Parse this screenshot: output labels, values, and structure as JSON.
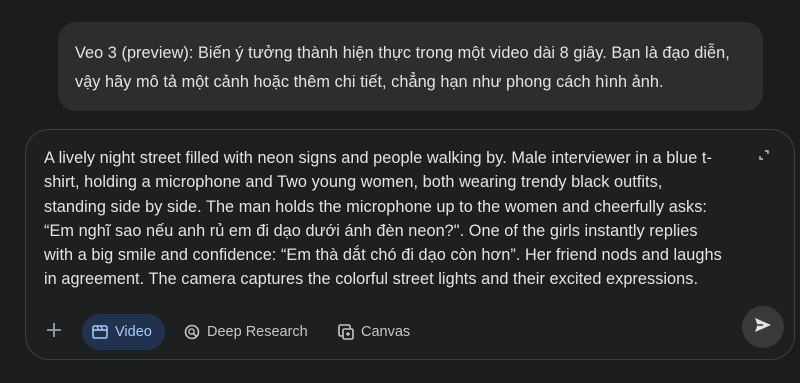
{
  "system_message": {
    "text": "Veo 3 (preview): Biến ý tưởng thành hiện thực trong một video dài 8 giây. Bạn là đạo diễn, vậy hãy mô tả một cảnh hoặc thêm chi tiết, chẳng hạn như phong cách hình ảnh."
  },
  "composer": {
    "prompt": "A lively night street filled with neon signs and people walking by. Male interviewer in a blue t-shirt, holding a microphone and Two young women, both wearing trendy black outfits, standing side by side. The man holds the microphone up to the women and cheerfully asks: “Em nghĩ sao nếu anh rủ em đi dạo dưới ánh đèn neon?\". One of the girls instantly replies with a big smile and confidence: “Em thà dắt chó đi dạo còn hơn”. Her friend nods and laughs in agreement. The camera captures the colorful street lights and their excited expressions.",
    "expand_icon": "expand-icon"
  },
  "toolbar": {
    "add_icon": "plus-icon",
    "tools": [
      {
        "label": "Video",
        "icon": "video-icon",
        "active": true
      },
      {
        "label": "Deep Research",
        "icon": "deep-research-icon",
        "active": false
      },
      {
        "label": "Canvas",
        "icon": "canvas-icon",
        "active": false
      }
    ],
    "send_icon": "send-icon"
  },
  "colors": {
    "background": "#1b1c1d",
    "bubble": "#2c2d2f",
    "text": "#e3e3e3",
    "active_chip_bg": "#20324d",
    "active_chip_text": "#a8c7fa",
    "muted": "#c4c7c5"
  }
}
